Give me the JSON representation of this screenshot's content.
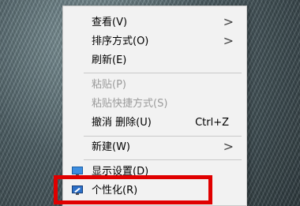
{
  "context_menu": {
    "items": [
      {
        "label": "查看(V)"
      },
      {
        "label": "排序方式(O)"
      },
      {
        "label": "刷新(E)"
      },
      {
        "label": "粘贴(P)"
      },
      {
        "label": "粘贴快捷方式(S)"
      },
      {
        "label": "撤消 删除(U)",
        "shortcut": "Ctrl+Z"
      },
      {
        "label": "新建(W)"
      },
      {
        "label": "显示设置(D)"
      },
      {
        "label": "个性化(R)"
      }
    ],
    "submenu_arrow": ">"
  },
  "colors": {
    "menu_bg": "#f2f2f2",
    "disabled_text": "#9b9b9b",
    "highlight_box": "#e00000"
  }
}
